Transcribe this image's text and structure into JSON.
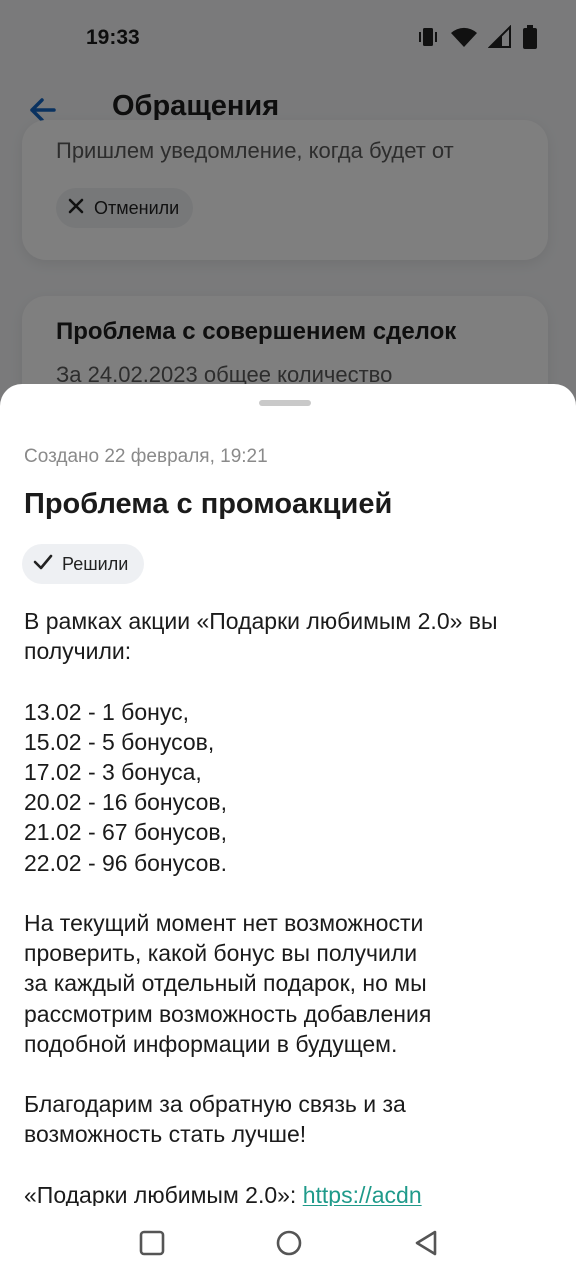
{
  "status_bar": {
    "time": "19:33",
    "icons": [
      "vibrate-icon",
      "wifi-icon",
      "signal-icon",
      "battery-icon"
    ]
  },
  "header": {
    "title": "Обращения",
    "back_icon": "arrow-left-icon"
  },
  "background_cards": [
    {
      "text": "Пришлем уведомление, когда будет от",
      "status": "Отменили",
      "status_icon": "close-icon"
    },
    {
      "title": "Проблема с совершением сделок",
      "text": "За 24.02.2023 общее количество"
    }
  ],
  "sheet": {
    "created": "Создано 22 февраля, 19:21",
    "title": "Проблема с промоакцией",
    "status": "Решили",
    "status_icon": "check-icon",
    "paragraphs": [
      "В рамках акции «Подарки любимым 2.0» вы получили:",
      "13.02 - 1 бонус,\n15.02 - 5 бонусов,\n17.02 - 3 бонуса,\n20.02 - 16 бонусов,\n21.02 - 67 бонусов,\n22.02 - 96 бонусов.",
      "На текущий момент нет возможности\nпроверить, какой бонус вы получили\nза каждый отдельный подарок, но мы\nрассмотрим возможность добавления\nподобной информации в будущем.",
      "Благодарим за обратную связь и за\nвозможность стать лучше!"
    ],
    "footer_prefix": "«Подарки любимым 2.0»: ",
    "footer_link": "https://acdn"
  },
  "nav_bar": {
    "icons": [
      "recents-square-icon",
      "home-circle-icon",
      "back-triangle-icon"
    ]
  },
  "colors": {
    "accent_blue": "#1565c0",
    "link_green": "#1f9a8a",
    "chip_bg": "#eef0f3"
  }
}
